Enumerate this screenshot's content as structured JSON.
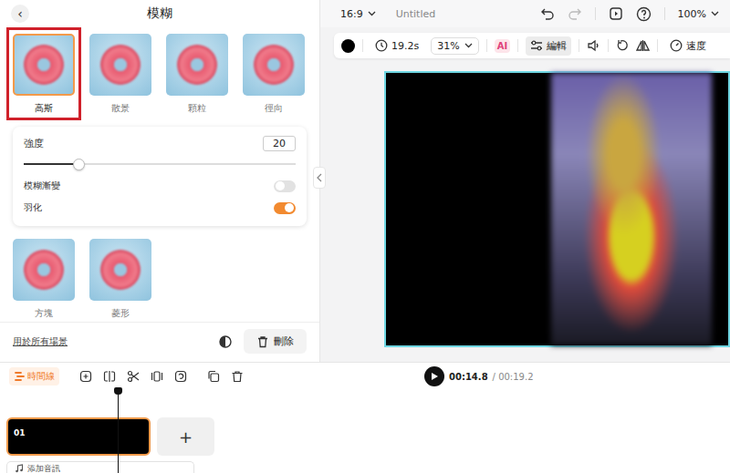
{
  "panel": {
    "back": "‹",
    "title": "模糊"
  },
  "effects": [
    {
      "label": "高斯",
      "selected": true
    },
    {
      "label": "散景",
      "selected": false
    },
    {
      "label": "顆粒",
      "selected": false
    },
    {
      "label": "徑向",
      "selected": false
    },
    {
      "label": "方塊",
      "selected": false
    },
    {
      "label": "菱形",
      "selected": false
    }
  ],
  "settings": {
    "strength": {
      "label": "強度",
      "value": "20",
      "level": 0.2
    },
    "toggles": [
      {
        "label": "模糊漸變",
        "on": false
      },
      {
        "label": "羽化",
        "on": true
      }
    ]
  },
  "footer": {
    "apply_all": "用於所有場景",
    "delete": "刪除"
  },
  "topbar": {
    "ratio": "16:9",
    "title": "Untitled",
    "zoom": "100%"
  },
  "toolbar": {
    "duration": "19.2s",
    "scale": "31%",
    "ai": "AI",
    "edit": {
      "label": "編輯",
      "selected": true
    },
    "speed": {
      "label": "速度",
      "selected": false
    }
  },
  "timeline": {
    "label": "時間線",
    "current": "00:14.8",
    "total": "/ 00:19.2",
    "clips": [
      {
        "label": "01",
        "selected": true
      }
    ],
    "add": "+",
    "add_audio": "添加音訊"
  }
}
